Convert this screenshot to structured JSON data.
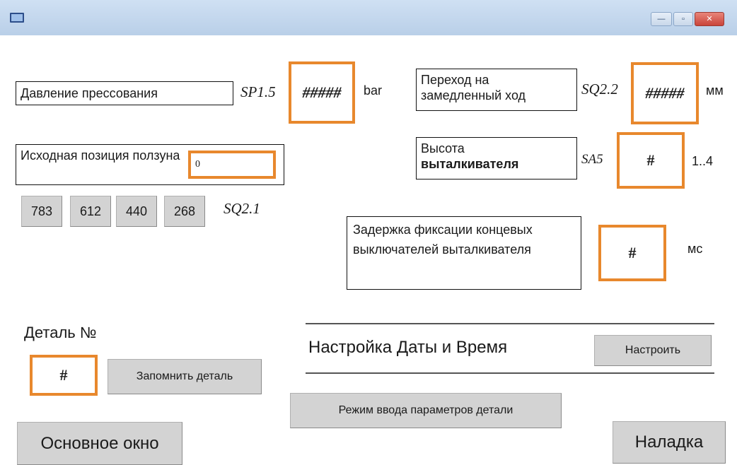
{
  "window": {
    "title": "",
    "icon": "window-app-icon",
    "controls": {
      "minimize": "—",
      "maximize": "▫",
      "close": "✕"
    }
  },
  "pressure": {
    "label": "Давление прессования",
    "tag": "SP1.5",
    "value": "#####",
    "unit": "bar"
  },
  "slowdown": {
    "label": "Переход на замедленный ход",
    "tag": "SQ2.2",
    "value": "#####",
    "unit": "мм"
  },
  "slider_pos": {
    "label": "Исходная позиция ползуна",
    "value": "0"
  },
  "ejector_height": {
    "label_line1": "Высота",
    "label_line2": "выталкивателя",
    "tag": "SA5",
    "value": "#",
    "range": "1..4"
  },
  "position_buttons": {
    "b1": "783",
    "b2": "612",
    "b3": "440",
    "b4": "268",
    "tag": "SQ2.1"
  },
  "delay": {
    "label": "Задержка фиксации концевых выключателей выталкивателя",
    "value": "#",
    "unit": "мс"
  },
  "part": {
    "label": "Деталь №",
    "value": "#",
    "remember_button": "Запомнить деталь"
  },
  "datetime": {
    "label": "Настройка Даты и Время",
    "button": "Настроить"
  },
  "part_params_button": "Режим ввода параметров детали",
  "main_window_button": "Основное окно",
  "adjust_button": "Наладка"
}
